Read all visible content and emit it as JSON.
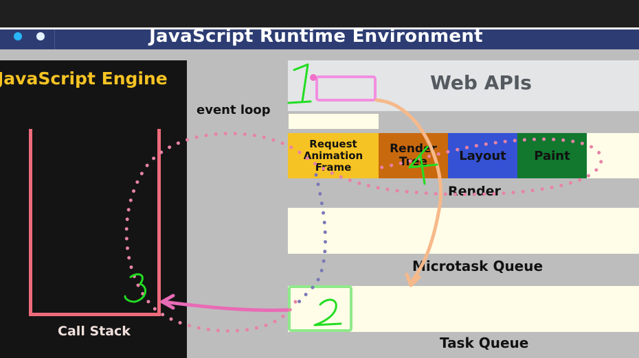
{
  "title": "JavaScript Runtime Environment",
  "engine": {
    "title": "JavaScript Engine",
    "call_stack_label": "Call Stack"
  },
  "event_loop_label": "event loop",
  "web_apis": {
    "label": "Web APIs"
  },
  "render": {
    "label": "Render",
    "steps": [
      "Request Animation Frame",
      "Render Tree",
      "Layout",
      "Paint"
    ]
  },
  "microtask_queue": {
    "label": "Microtask Queue"
  },
  "task_queue": {
    "label": "Task Queue"
  },
  "annotations": [
    "1",
    "2",
    "3",
    "4"
  ],
  "colors": {
    "title_bar": "#2d3d73",
    "engine_bg": "#141414",
    "engine_title": "#f6c324",
    "call_stack": "#ef6b7c",
    "raf": "#f6c324",
    "render_tree": "#c9690e",
    "layout": "#3552d5",
    "paint": "#11782e",
    "lane": "#fffde8",
    "annotation_pen": "#22dd22",
    "highlight_pink": "#f28fe0",
    "highlight_green": "#8fe98a"
  }
}
